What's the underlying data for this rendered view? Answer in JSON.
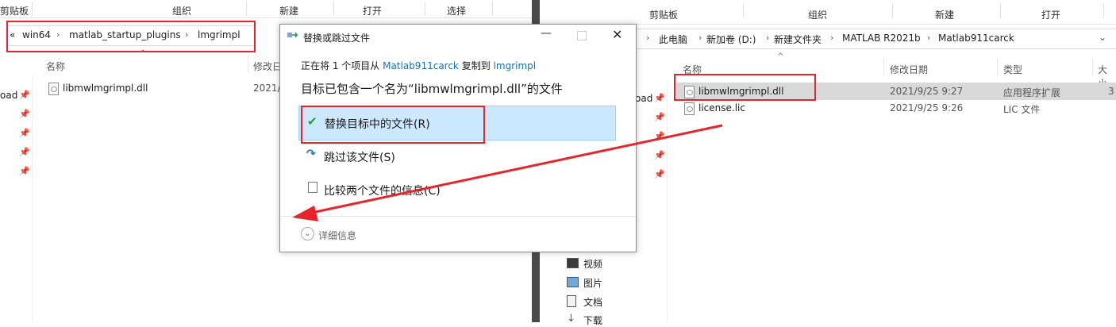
{
  "left_window": {
    "ribbon": {
      "clipboard": "剪贴板",
      "organize": "组织",
      "new": "新建",
      "open": "打开",
      "select": "选择"
    },
    "breadcrumb": {
      "overflow": "«",
      "items": [
        "win64",
        "matlab_startup_plugins",
        "lmgrimpl"
      ]
    },
    "columns": {
      "name": "名称",
      "modified": "修改日"
    },
    "files": [
      {
        "name": "libmwlmgrimpl.dll",
        "modified": "2021/"
      }
    ],
    "nav_partial": "oad"
  },
  "right_window": {
    "ribbon": {
      "clipboard": "剪贴板",
      "organize": "组织",
      "new": "新建",
      "open": "打开"
    },
    "breadcrumb": {
      "items": [
        "此电脑",
        "新加卷 (D:)",
        "新建文件夹",
        "MATLAB R2021b",
        "Matlab911carck"
      ]
    },
    "columns": {
      "name": "名称",
      "modified": "修改日期",
      "type": "类型",
      "size": "大小"
    },
    "files": [
      {
        "name": "libmwlmgrimpl.dll",
        "modified": "2021/9/25 9:27",
        "type": "应用程序扩展",
        "size": "3"
      },
      {
        "name": "license.lic",
        "modified": "2021/9/25 9:26",
        "type": "LIC 文件"
      }
    ],
    "nav_partial": "oad",
    "nav": [
      "视频",
      "图片",
      "文档",
      "下载"
    ]
  },
  "dialog": {
    "title": "替换或跳过文件",
    "copy_prefix": "正在将 1 个项目从",
    "source": "Matlab911carck",
    "copy_mid": "复制到",
    "dest": "lmgrimpl",
    "heading": "目标已包含一个名为“libmwlmgrimpl.dll”的文件",
    "replace": "替换目标中的文件(R)",
    "skip": "跳过该文件(S)",
    "compare": "比较两个文件的信息(C)",
    "details": "详细信息"
  },
  "colors": {
    "accent_link": "#1a6fb5",
    "highlight": "#cce8ff",
    "annotation_red": "#e8242a",
    "selected_row": "#d9d9d9"
  }
}
